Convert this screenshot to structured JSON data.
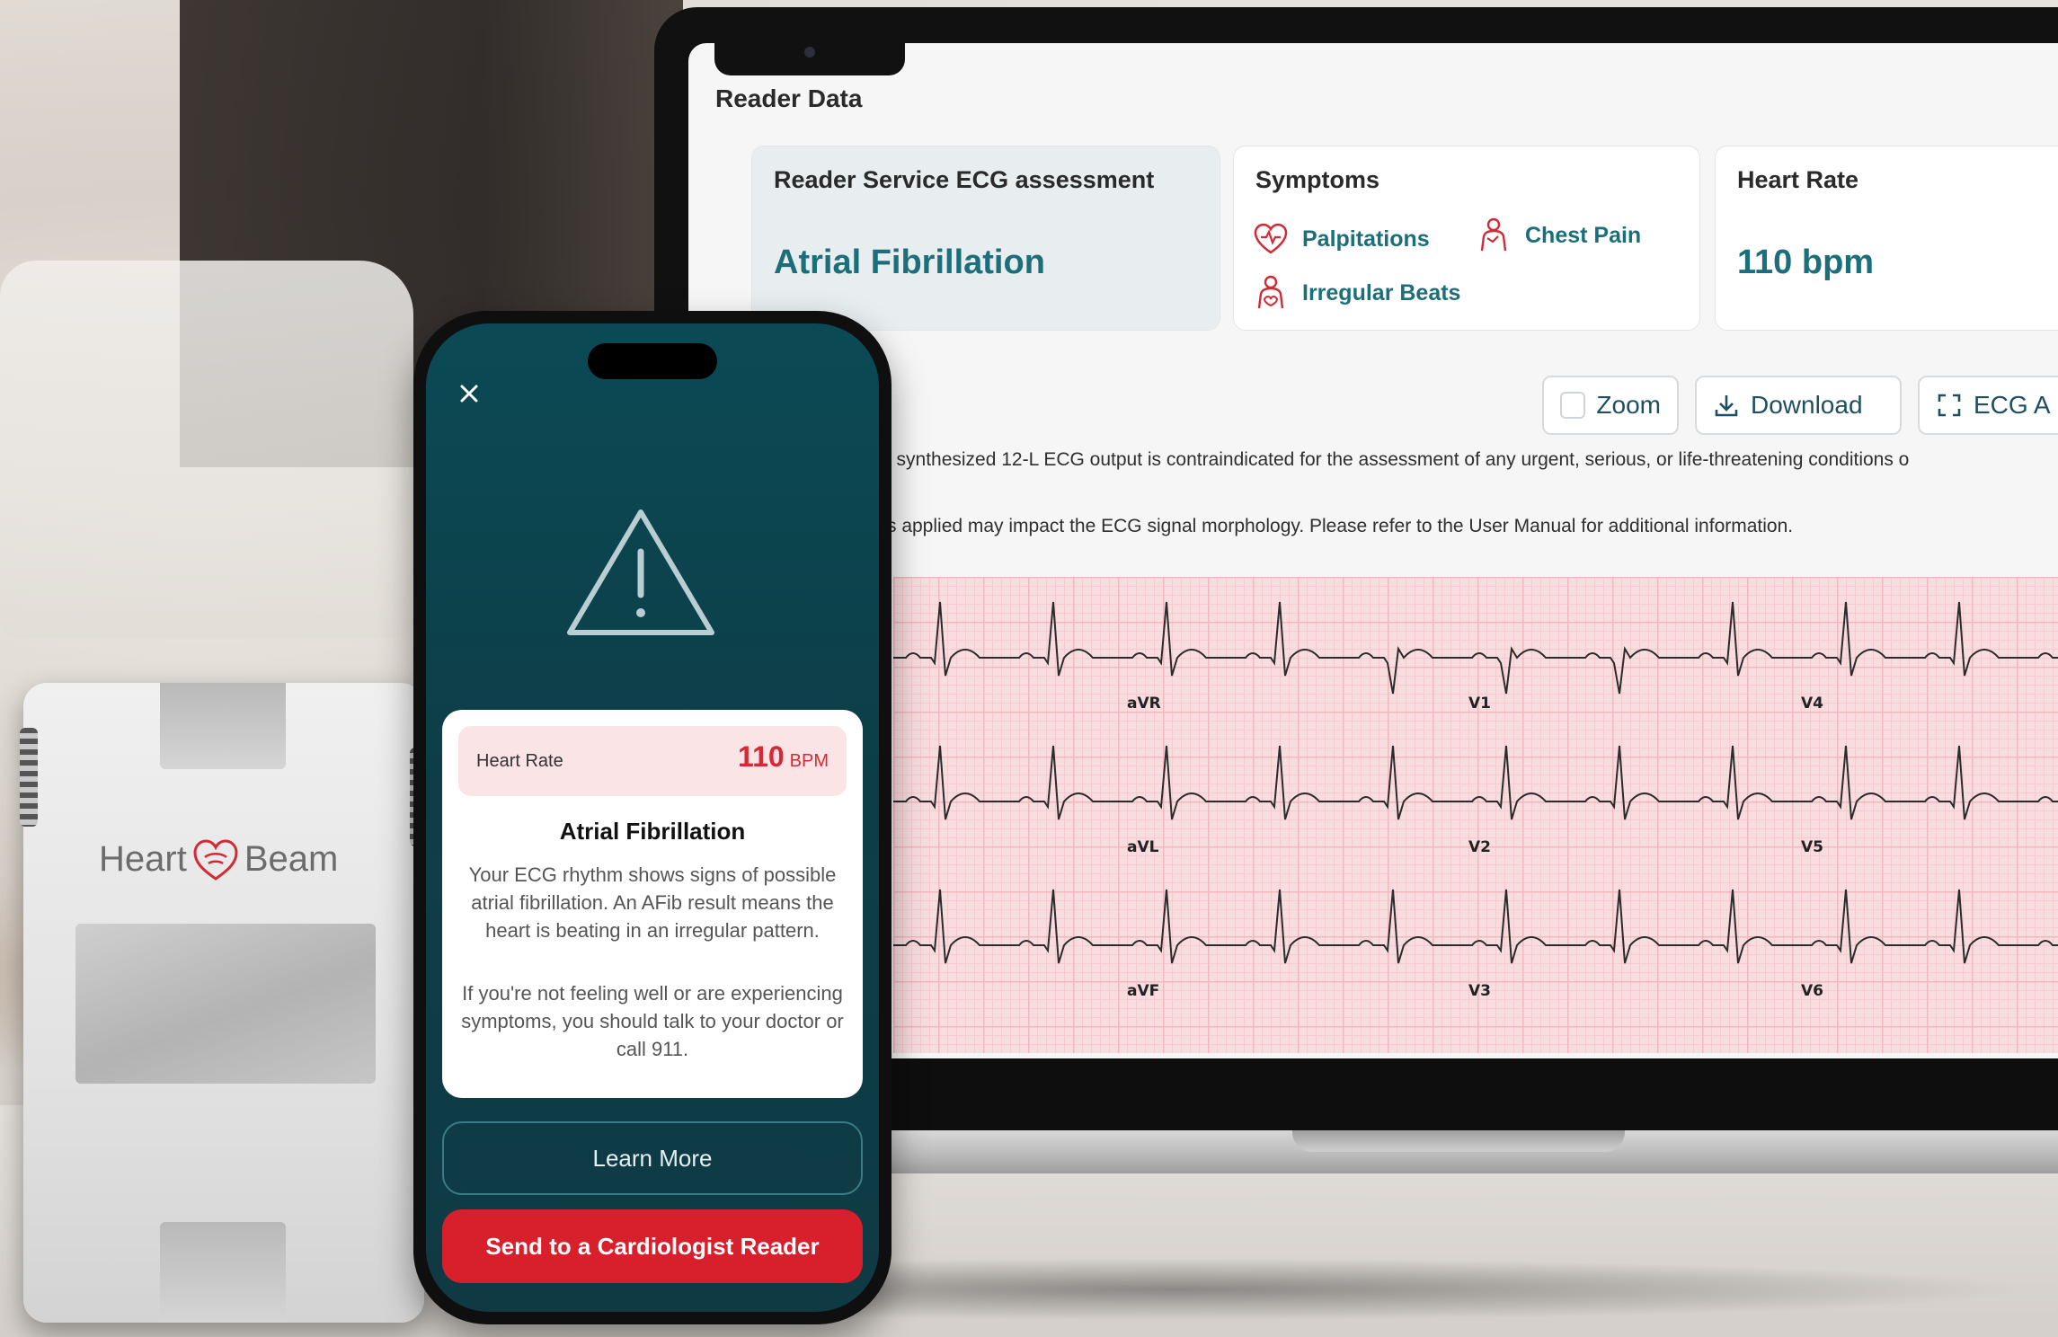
{
  "laptop": {
    "section_title": "Reader Data",
    "assessment": {
      "label": "Reader Service ECG assessment",
      "value": "Atrial Fibrillation"
    },
    "symptoms": {
      "label": "Symptoms",
      "items": [
        {
          "name": "Palpitations",
          "icon": "heart-pulse-icon"
        },
        {
          "name": "Chest Pain",
          "icon": "chest-pain-icon"
        },
        {
          "name": "Irregular Beats",
          "icon": "irregular-beats-icon"
        }
      ]
    },
    "heart_rate": {
      "label": "Heart Rate",
      "value": "110 bpm"
    },
    "toolbar": {
      "zoom_label": "Zoom",
      "download_label": "Download",
      "ecg_all_label": "ECG A"
    },
    "notices": [
      "e synthesized 12-L ECG output is contraindicated for the assessment of any urgent, serious, or life-threatening conditions o",
      "rs applied may impact the ECG signal morphology. Please refer to the User Manual for additional information."
    ],
    "ecg_leads": [
      "aVR",
      "V1",
      "V4",
      "aVL",
      "V2",
      "V5",
      "aVF",
      "V3",
      "V6"
    ],
    "colors": {
      "accent": "#1c6f7a",
      "ecg_grid": "#efb9be",
      "ecg_bg": "#f8dde0"
    }
  },
  "phone": {
    "close_icon": "close-icon",
    "warning_icon": "warning-triangle-icon",
    "heart_rate_label": "Heart Rate",
    "heart_rate_value": "110",
    "heart_rate_unit": "BPM",
    "result_title": "Atrial Fibrillation",
    "result_text": "Your ECG rhythm shows signs of possible atrial fibrillation. An AFib result means the heart is beating in an irregular pattern.",
    "advice_text": "If you're not feeling well or are experiencing symptoms, you should talk to your doctor or call 911.",
    "learn_more_label": "Learn More",
    "send_label": "Send to a Cardiologist Reader",
    "colors": {
      "screen_bg": "#0d3f49",
      "alert_red": "#d81f2c"
    }
  },
  "device": {
    "brand_part1": "Heart",
    "brand_part2": "Beam"
  }
}
